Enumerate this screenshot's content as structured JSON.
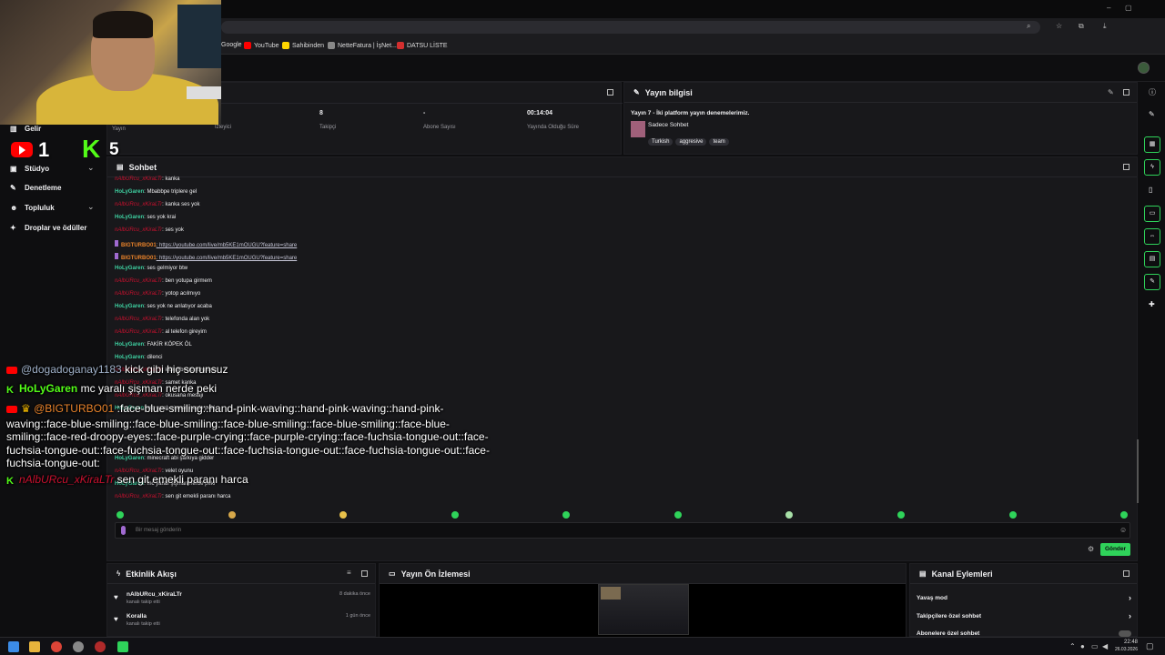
{
  "browser": {
    "bookmarks": [
      "Google",
      "YouTube",
      "Sahibinden",
      "NetteFatura | İşNet...",
      "DATSU LİSTE"
    ]
  },
  "overlay_counts": {
    "youtube_viewers": "1",
    "kick_viewers": "5"
  },
  "sidebar": {
    "items": [
      {
        "label": "Gelir",
        "icon": "bank-icon"
      },
      {
        "label": "Stüdyo",
        "icon": "studio-icon"
      },
      {
        "label": "Denetleme",
        "icon": "wrench-icon"
      },
      {
        "label": "Topluluk",
        "icon": "community-icon"
      },
      {
        "label": "Droplar ve ödüller",
        "icon": "gift-icon"
      }
    ],
    "stream_label": "Yayın"
  },
  "stats": [
    {
      "value": "",
      "label": "İzleyici"
    },
    {
      "value": "8",
      "label": "Takipçi"
    },
    {
      "value": "-",
      "label": "Abone Sayısı"
    },
    {
      "value": "00:14:04",
      "label": "Yayında Olduğu Süre"
    }
  ],
  "stream_info": {
    "title": "Yayın bilgisi",
    "stream_title": "Yayın 7 - İki platform yayın denemelerimiz.",
    "category": "Sadece Sohbet",
    "tags": [
      "Turkish",
      "aggresive",
      "team"
    ]
  },
  "chat": {
    "title": "Sohbet",
    "placeholder": "Bir mesaj gönderin",
    "send_label": "Gönder",
    "messages": [
      {
        "user": "nAlbURcu_xKiraLTr",
        "text": ": kanka",
        "kind": "red"
      },
      {
        "user": "HoLyGaren",
        "text": ": Mbabbpe triplere gel",
        "kind": "green"
      },
      {
        "user": "nAlbURcu_xKiraLTr",
        "text": ": kanka ses yok",
        "kind": "red"
      },
      {
        "user": "HoLyGaren",
        "text": ": ses yok krai",
        "kind": "green"
      },
      {
        "user": "nAlbURcu_xKiraLTr",
        "text": ": ses yok",
        "kind": "red"
      },
      {
        "user": "BIGTURBO01",
        "text": ": https://youtube.com/live/mb5KE1mOUGU?feature=share",
        "kind": "orange"
      },
      {
        "user": "BIGTURBO01",
        "text": ": https://youtube.com/live/mb5KE1mOUGU?feature=share",
        "kind": "orange"
      },
      {
        "user": "HoLyGaren",
        "text": ": ses gelmiyor btw",
        "kind": "green"
      },
      {
        "user": "nAlbURcu_xKiraLTr",
        "text": ": ben yotupa girmem",
        "kind": "red"
      },
      {
        "user": "nAlbURcu_xKiraLTr",
        "text": ": yotop acılmıyo",
        "kind": "red"
      },
      {
        "user": "HoLyGaren",
        "text": ": ses yok ne anlatıyor acaba",
        "kind": "green"
      },
      {
        "user": "nAlbURcu_xKiraLTr",
        "text": ": telefonda alan yok",
        "kind": "red"
      },
      {
        "user": "nAlbURcu_xKiraLTr",
        "text": ": al telefon gireyim",
        "kind": "red"
      },
      {
        "user": "HoLyGaren",
        "text": ": FAKİR KÖPEK ÖL",
        "kind": "green"
      },
      {
        "user": "HoLyGaren",
        "text": ": dilenci",
        "kind": "green"
      },
      {
        "user": "nAlbURcu_xKiraLTr",
        "text": ": kick gibi hiç sorunsuz",
        "kind": "red"
      },
      {
        "user": "nAlbURcu_xKiraLTr",
        "text": ": samet kanka",
        "kind": "red"
      },
      {
        "user": "nAlbURcu_xKiraLTr",
        "text": ": okusana mesajı",
        "kind": "red"
      },
      {
        "user": "HoLyGaren",
        "text": ": mc yaralı şişman nerde peki",
        "kind": "green"
      },
      {
        "user": "HoLyGaren",
        "text": ": minecraft abi şarkıya gidder",
        "kind": "green"
      },
      {
        "user": "nAlbURcu_xKiraLTr",
        "text": ": velet oyunu",
        "kind": "red"
      },
      {
        "user": "HoLyGaren",
        "text": ": mc yaralı şişman nerde peki",
        "kind": "green"
      },
      {
        "user": "nAlbURcu_xKiraLTr",
        "text": ": sen git emekli paranı harca",
        "kind": "red"
      }
    ]
  },
  "overlay_chat": [
    {
      "platform": "youtube",
      "user": "@dogadoganay1183",
      "text": "kick gibi hiç sorunsuz"
    },
    {
      "platform": "kick",
      "user": "HoLyGaren",
      "text": "mc yaralı şişman nerde peki"
    },
    {
      "platform": "youtube",
      "user": "@BIGTURBO01",
      "text": ":face-blue-smiling::hand-pink-waving::hand-pink-waving::hand-pink-"
    },
    {
      "platform": "none",
      "user": "",
      "text": "waving::face-blue-smiling::face-blue-smiling::face-blue-smiling::face-blue-smiling::face-blue-"
    },
    {
      "platform": "none",
      "user": "",
      "text": "smiling::face-red-droopy-eyes::face-purple-crying::face-purple-crying::face-fuchsia-tongue-out::face-"
    },
    {
      "platform": "none",
      "user": "",
      "text": "fuchsia-tongue-out::face-fuchsia-tongue-out::face-fuchsia-tongue-out::face-fuchsia-tongue-out::face-"
    },
    {
      "platform": "none",
      "user": "",
      "text": "fuchsia-tongue-out:"
    },
    {
      "platform": "kick",
      "user": "nAlbURcu_xKiraLTr",
      "text": "sen git emekli paranı harca"
    }
  ],
  "activity": {
    "title": "Etkinlik Akışı",
    "items": [
      {
        "user": "nAlbURcu_xKiraLTr",
        "sub": "kanalı takip etti",
        "time": "8 dakika önce"
      },
      {
        "user": "Koralla",
        "sub": "kanalı takip etti",
        "time": "1 gün önce"
      }
    ]
  },
  "preview": {
    "title": "Yayın Ön İzlemesi"
  },
  "channel_actions": {
    "title": "Kanal Eylemleri",
    "items": [
      "Yavaş mod",
      "Takipçilere özel sohbet",
      "Abonelere özel sohbet"
    ]
  },
  "taskbar": {
    "time": "22:48",
    "date": "26.03.2026"
  },
  "colors": {
    "kick_green": "#53fc18",
    "accent": "#2fd35a",
    "youtube_red": "#ff0000"
  }
}
